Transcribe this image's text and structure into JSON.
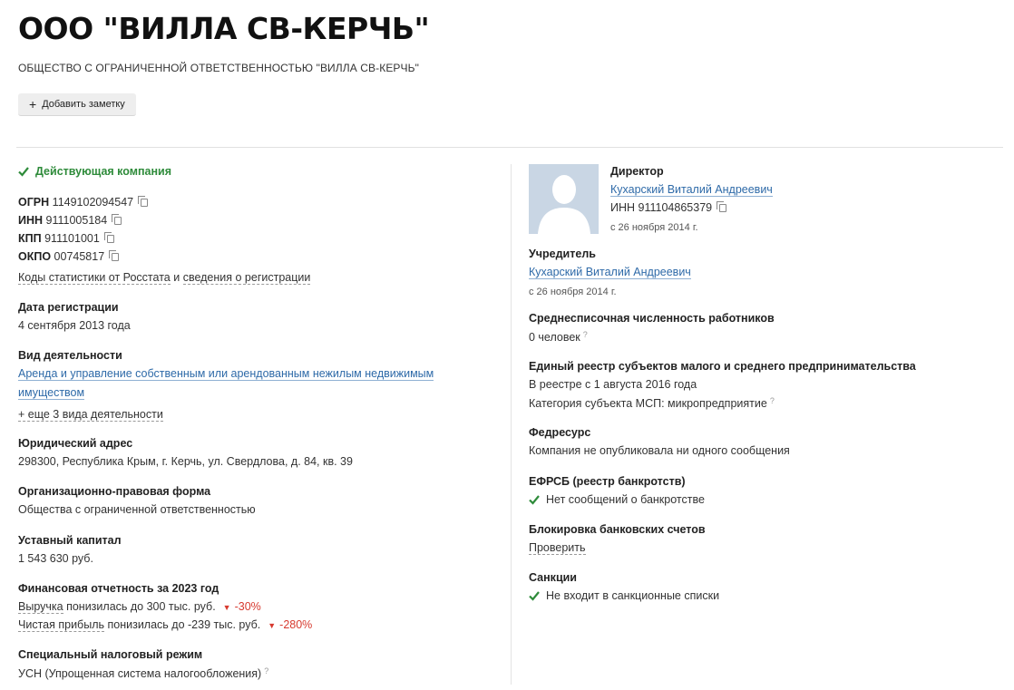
{
  "header": {
    "title": "ООО \"ВИЛЛА СВ-КЕРЧЬ\"",
    "full_name": "ОБЩЕСТВО С ОГРАНИЧЕННОЙ ОТВЕТСТВЕННОСТЬЮ \"ВИЛЛА СВ-КЕРЧЬ\"",
    "add_note_label": "Добавить заметку"
  },
  "left": {
    "status": "Действующая компания",
    "ids": {
      "ogrn_label": "ОГРН",
      "ogrn": "1149102094547",
      "inn_label": "ИНН",
      "inn": "9111005184",
      "kpp_label": "КПП",
      "kpp": "911101001",
      "okpo_label": "ОКПО",
      "okpo": "00745817"
    },
    "stats_link": "Коды статистики от Росстата",
    "stats_and": "и",
    "registration_link": "сведения о регистрации",
    "reg_date_label": "Дата регистрации",
    "reg_date": "4 сентября 2013 года",
    "activity_label": "Вид деятельности",
    "activity_line1": "Аренда и управление собственным или арендованным нежилым недвижимым",
    "activity_line2": "имуществом",
    "activity_more": "+ еще 3 вида деятельности",
    "address_label": "Юридический адрес",
    "address": "298300, Республика Крым, г. Керчь, ул. Свердлова, д. 84, кв. 39",
    "legal_form_label": "Организационно-правовая форма",
    "legal_form": "Общества с ограниченной ответственностью",
    "capital_label": "Уставный капитал",
    "capital": "1 543 630 руб.",
    "finance_label": "Финансовая отчетность за 2023 год",
    "revenue_link": "Выручка",
    "revenue_text": "понизилась до 300 тыс. руб.",
    "revenue_change": "-30%",
    "profit_link": "Чистая прибыль",
    "profit_text": "понизилась до -239 тыс. руб.",
    "profit_change": "-280%",
    "tax_label": "Специальный налоговый режим",
    "tax": "УСН (Упрощенная система налогообложения)"
  },
  "right": {
    "director_label": "Директор",
    "director_name": "Кухарский Виталий Андреевич",
    "director_inn_label": "ИНН",
    "director_inn": "911104865379",
    "director_since": "с 26 ноября 2014 г.",
    "founder_label": "Учредитель",
    "founder_name": "Кухарский Виталий Андреевич",
    "founder_since": "с 26 ноября 2014 г.",
    "employees_label": "Среднесписочная численность работников",
    "employees": "0 человек",
    "msp_label": "Единый реестр субъектов малого и среднего предпринимательства",
    "msp_since": "В реестре с 1 августа 2016 года",
    "msp_category": "Категория субъекта МСП: микропредприятие",
    "fedresurs_label": "Федресурс",
    "fedresurs": "Компания не опубликовала ни одного сообщения",
    "efrsb_label": "ЕФРСБ (реестр банкротств)",
    "efrsb": "Нет сообщений о банкротстве",
    "block_label": "Блокировка банковских счетов",
    "block_check": "Проверить",
    "sanctions_label": "Санкции",
    "sanctions": "Не входит в санкционные списки"
  },
  "colors": {
    "link": "#2e6aa8",
    "green": "#2e8b3a",
    "red": "#d73a2f"
  },
  "icons": [
    "plus-icon",
    "check-icon",
    "copy-icon",
    "question-icon",
    "arrow-down-icon",
    "avatar-placeholder"
  ]
}
